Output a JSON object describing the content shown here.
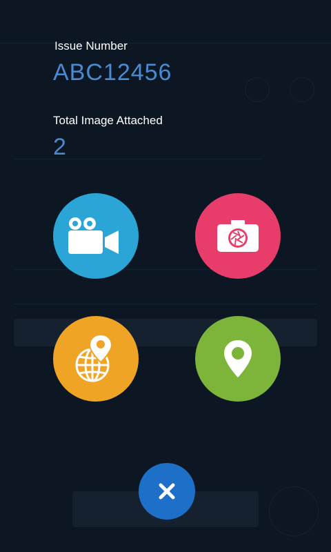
{
  "issue": {
    "number_label": "Issue Number",
    "number_value": "ABC12456",
    "images_label": "Total Image Attached",
    "images_value": "2"
  },
  "actions": [
    {
      "name": "video",
      "icon": "video-camera-icon",
      "color": "#2aa5d5"
    },
    {
      "name": "photo",
      "icon": "photo-camera-icon",
      "color": "#e83d6b"
    },
    {
      "name": "geo",
      "icon": "globe-pin-icon",
      "color": "#f0a425"
    },
    {
      "name": "location",
      "icon": "map-pin-icon",
      "color": "#7db43a"
    }
  ],
  "close": {
    "icon": "close-icon",
    "color": "#1e6fc8"
  },
  "colors": {
    "background": "#0d1723",
    "label": "#ffffff",
    "value": "#4a8ad0"
  }
}
